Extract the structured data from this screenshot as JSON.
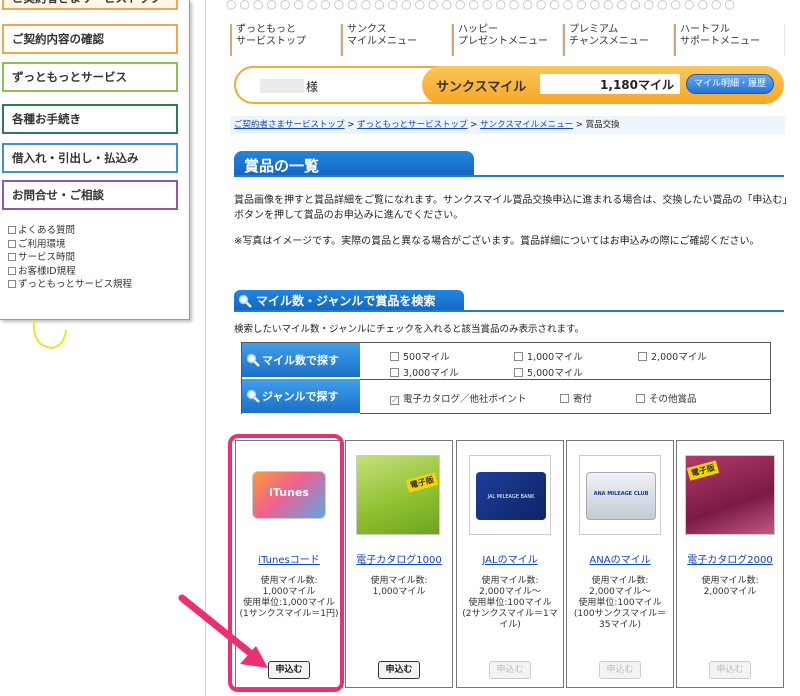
{
  "sidebar": {
    "top_button": "ご契約者さまサービストップ",
    "buttons": [
      {
        "label": "ご契約内容の確認",
        "color": "#f0a64a"
      },
      {
        "label": "ずっともっとサービス",
        "color": "#8cc152"
      },
      {
        "label": "各種お手続き",
        "color": "#2e7d4f"
      },
      {
        "label": "借入れ・引出し・払込み",
        "color": "#3b8fe0"
      },
      {
        "label": "お問合せ・ご相談",
        "color": "#8a5ab8"
      }
    ],
    "links": [
      "よくある質問",
      "ご利用環境",
      "サービス時間",
      "お客様ID規程",
      "ずっともっとサービス規程"
    ]
  },
  "tabs": [
    {
      "line1": "ずっともっと",
      "line2": "サービストップ"
    },
    {
      "line1": "サンクス",
      "line2": "マイルメニュー"
    },
    {
      "line1": "ハッピー",
      "line2": "プレゼントメニュー"
    },
    {
      "line1": "プレミアム",
      "line2": "チャンスメニュー"
    },
    {
      "line1": "ハートフル",
      "line2": "サポートメニュー"
    }
  ],
  "account": {
    "honorific": "様",
    "miles_label": "サンクスマイル",
    "miles_value": "1,180マイル",
    "detail_button": "マイル明細・履歴"
  },
  "breadcrumb": {
    "items": [
      "ご契約者さまサービストップ",
      "ずっともっとサービストップ",
      "サンクスマイルメニュー"
    ],
    "separator": " > ",
    "current": "賞品交換"
  },
  "page_title": "賞品の一覧",
  "intro_text": "賞品画像を押すと賞品詳細をご覧になれます。サンクスマイル賞品交換申込に進まれる場合は、交換したい賞品の「申込む」ボタンを押して賞品のお申込みに進んでください。",
  "note_text": "※写真はイメージです。実際の賞品と異なる場合がございます。賞品詳細についてはお申込みの際にご確認ください。",
  "search": {
    "title": "マイル数・ジャンルで賞品を検索",
    "description": "検索したいマイル数・ジャンルにチェックを入れると該当賞品のみ表示されます。",
    "mile_label": "マイル数で探す",
    "genre_label": "ジャンルで探す",
    "mile_options": [
      "500マイル",
      "1,000マイル",
      "2,000マイル",
      "3,000マイル",
      "5,000マイル"
    ],
    "genre_options": [
      {
        "label": "電子カタログ／他社ポイント",
        "checked": true
      },
      {
        "label": "寄付",
        "checked": false
      },
      {
        "label": "その他賞品",
        "checked": false
      }
    ]
  },
  "products": [
    {
      "name": "iTunesコード",
      "usage_label": "使用マイル数:",
      "miles": "1,000マイル",
      "unit_label": "使用単位:1,000マイル",
      "unit_note": "(1サンクスマイル＝1円)",
      "button": "申込む",
      "enabled": true,
      "image_text": "iTunes"
    },
    {
      "name": "電子カタログ1000",
      "usage_label": "使用マイル数:",
      "miles": "1,000マイル",
      "unit_label": "",
      "unit_note": "",
      "button": "申込む",
      "enabled": true,
      "image_text": "電子版"
    },
    {
      "name": "JALのマイル",
      "usage_label": "使用マイル数:",
      "miles": "2,000マイル〜",
      "unit_label": "使用単位:100マイル",
      "unit_note": "(2サンクスマイル＝1マイル)",
      "button": "申込む",
      "enabled": false,
      "image_text": "JAL MILEAGE BANK"
    },
    {
      "name": "ANAのマイル",
      "usage_label": "使用マイル数:",
      "miles": "2,000マイル〜",
      "unit_label": "使用単位:100マイル",
      "unit_note": "(100サンクスマイル＝35マイル)",
      "button": "申込む",
      "enabled": false,
      "image_text": "ANA MILEAGE CLUB"
    },
    {
      "name": "電子カタログ2000",
      "usage_label": "使用マイル数:",
      "miles": "2,000マイル",
      "unit_label": "",
      "unit_note": "",
      "button": "申込む",
      "enabled": false,
      "image_text": "電子版"
    }
  ]
}
